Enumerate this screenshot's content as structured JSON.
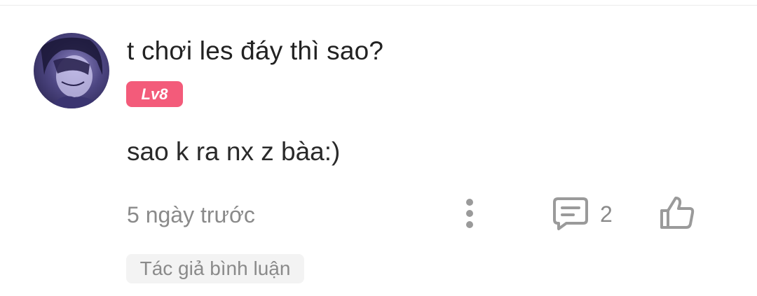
{
  "comment": {
    "username": "t chơi les đáy thì sao?",
    "level_badge": "Lv8",
    "text": "sao k ra nx z bàa:)",
    "timestamp": "5 ngày trước",
    "reply_count": "2",
    "author_replied_tag": "Tác giả bình luận",
    "avatar_icon": "anime-avatar",
    "more_icon": "more-vertical-icon",
    "reply_icon": "comment-bubble-icon",
    "like_icon": "thumbs-up-icon"
  },
  "colors": {
    "badge": "#f35b7a",
    "secondary_text": "#8a8a8a",
    "primary_text": "#222222",
    "tag_background": "#f3f3f3"
  }
}
